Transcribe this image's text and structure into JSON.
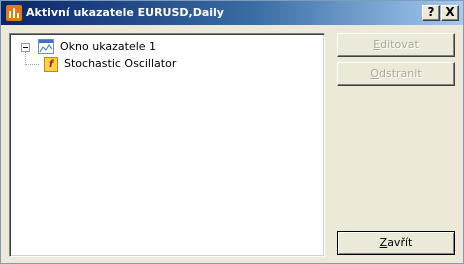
{
  "window": {
    "title": "Aktivní ukazatele EURUSD,Daily",
    "help_label": "?",
    "close_label": "X"
  },
  "tree": {
    "root": {
      "label": "Okno ukazatele 1",
      "icon": "indicator-window-icon",
      "expanded": true
    },
    "children": [
      {
        "label": "Stochastic Oscillator",
        "icon": "function-icon"
      }
    ]
  },
  "buttons": {
    "edit": {
      "accel": "E",
      "rest": "ditovat",
      "enabled": false
    },
    "remove": {
      "accel": "O",
      "rest": "dstranit",
      "enabled": false
    },
    "close": {
      "accel": "Z",
      "rest": "avřít",
      "enabled": true
    }
  }
}
